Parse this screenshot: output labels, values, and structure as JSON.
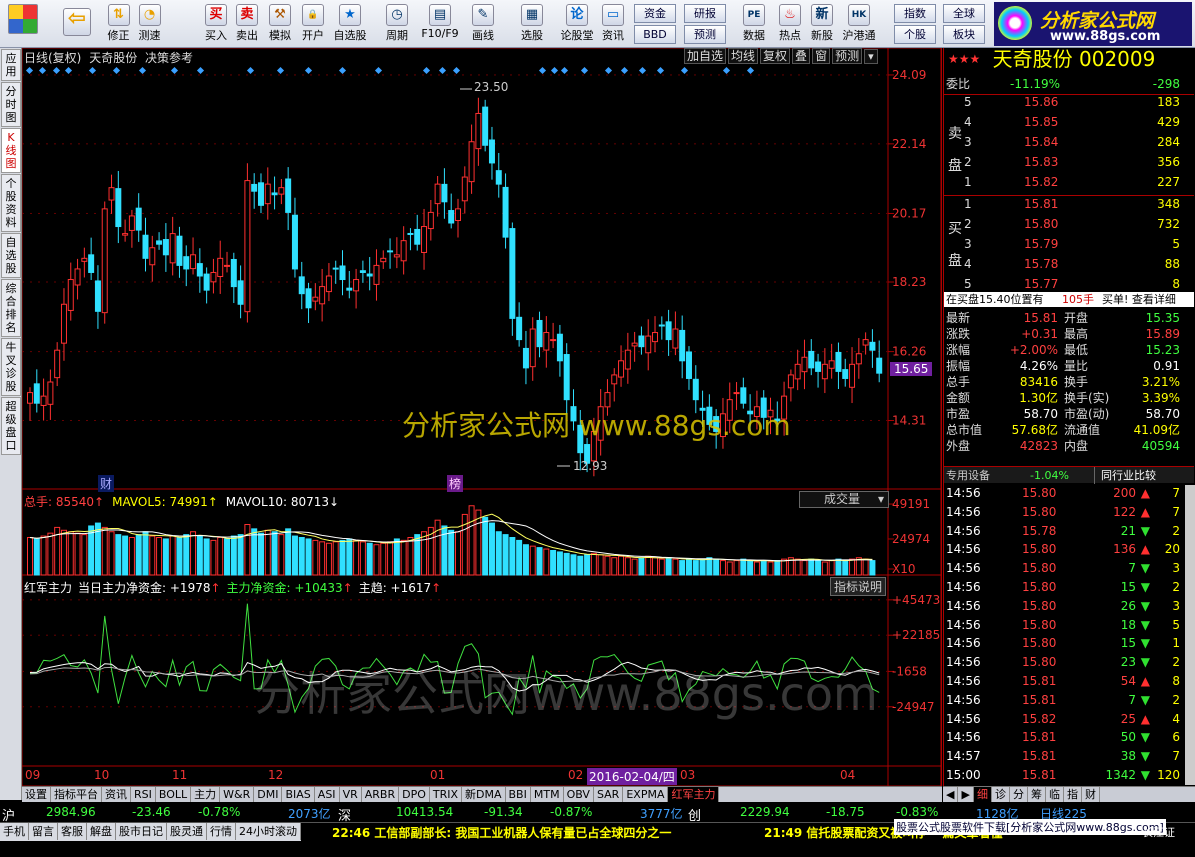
{
  "toolbar": {
    "left_buttons": [
      {
        "label": "买入",
        "icon": "buy-icon"
      },
      {
        "label": "卖出",
        "icon": "sell-icon"
      },
      {
        "label": "模拟",
        "icon": "hammer-icon"
      },
      {
        "label": "开户",
        "icon": "lock-icon"
      },
      {
        "label": "自选股",
        "icon": "star-icon"
      },
      {
        "label": "周期",
        "icon": "clock-icon"
      },
      {
        "label": "F10/F9",
        "icon": "f10-icon"
      },
      {
        "label": "画线",
        "icon": "pencil-icon"
      },
      {
        "label": "选股",
        "icon": "filter-icon"
      },
      {
        "label": "论股堂",
        "icon": "lun-icon"
      },
      {
        "label": "资讯",
        "icon": "doc-icon"
      },
      {
        "label": "数据",
        "icon": "pe-icon"
      },
      {
        "label": "热点",
        "icon": "fire-icon"
      },
      {
        "label": "新股",
        "icon": "newstock-icon"
      },
      {
        "label": "沪港通",
        "icon": "hk-icon"
      }
    ],
    "nav_buttons": [
      {
        "label": "修正",
        "icon": "up-down-icon"
      },
      {
        "label": "测速",
        "icon": "speed-icon"
      }
    ],
    "wide_buttons": [
      "资金",
      "研报",
      "BBD",
      "预测",
      "指数",
      "全球",
      "个股",
      "板块"
    ],
    "logo_text": "分析家公式网",
    "logo_url": "www.88gs.com"
  },
  "left_tabs": [
    {
      "label": "应用"
    },
    {
      "label": "分时图"
    },
    {
      "label": "K线图",
      "selected": true
    },
    {
      "label": "个股资料"
    },
    {
      "label": "自选股"
    },
    {
      "label": "综合排名"
    },
    {
      "label": "牛叉诊股"
    },
    {
      "label": "超级盘口"
    }
  ],
  "chart_header": {
    "title": "日线(复权)",
    "stock": "天奇股份",
    "mode": "决策参考",
    "buttons": [
      "加自选",
      "均线",
      "复权",
      "叠",
      "窗",
      "预测"
    ]
  },
  "watermark": "分析家公式网 www.88gs.com",
  "watermark2": "分析家公式网www.88gs.com",
  "price_axis": [
    "24.09",
    "22.14",
    "20.17",
    "18.23",
    "16.26",
    "14.31"
  ],
  "current_price_tag": "15.65",
  "hi_label": "23.50",
  "lo_label": "12.93",
  "event_labels": [
    "财",
    "榜"
  ],
  "volume_panel": {
    "header": [
      {
        "text": "总手: 85540",
        "color": "#ff4040"
      },
      {
        "text": "MAVOL5: 74991",
        "color": "#ffff00"
      },
      {
        "text": "MAVOL10: 80713",
        "color": "#ffffff"
      }
    ],
    "dropdown": "成交量",
    "axis": [
      "49191",
      "24974",
      "X10"
    ]
  },
  "indicator_panel": {
    "header": [
      {
        "text": "红军主力",
        "color": "#ffffff"
      },
      {
        "text": "当日主力净资金: +1978",
        "color": "#ffffff"
      },
      {
        "text": "主力净资金: +10433",
        "color": "#40ff40"
      },
      {
        "text": "主趋: +1617",
        "color": "#ffffff"
      }
    ],
    "button": "指标说明",
    "axis": [
      "+45473",
      "+22185",
      "-1658",
      "-24947"
    ]
  },
  "x_axis": [
    "09",
    "10",
    "11",
    "12",
    "01",
    "02",
    "03",
    "04"
  ],
  "x_cursor_date": "2016-02-04/四",
  "bottom_tabs": [
    "设置",
    "指标平台",
    "资讯",
    "RSI",
    "BOLL",
    "主力",
    "W&R",
    "DMI",
    "BIAS",
    "ASI",
    "VR",
    "ARBR",
    "DPO",
    "TRIX",
    "新DMA",
    "BBI",
    "MTM",
    "OBV",
    "SAR",
    "EXPMA",
    "红军主力"
  ],
  "right_tabs": [
    "细",
    "诊",
    "分",
    "筹",
    "临",
    "指",
    "财"
  ],
  "chart_data": {
    "type": "candlestick",
    "title": "天奇股份 日线(复权)",
    "ylim": [
      12.93,
      24.09
    ],
    "price_ticks": [
      24.09,
      22.14,
      20.17,
      18.23,
      16.26,
      14.31
    ],
    "high": 23.5,
    "low": 12.93,
    "last": 15.65,
    "close": [
      15.1,
      14.8,
      15.0,
      15.4,
      16.3,
      17.6,
      18.3,
      18.6,
      18.9,
      18.5,
      17.4,
      20.3,
      20.9,
      19.8,
      19.6,
      20.1,
      19.7,
      18.9,
      19.2,
      19.3,
      19.0,
      19.6,
      18.7,
      18.6,
      19.0,
      18.4,
      18.0,
      18.5,
      18.9,
      18.7,
      18.1,
      17.6,
      21.1,
      20.8,
      20.4,
      21.0,
      20.7,
      20.9,
      20.2,
      18.6,
      17.9,
      17.5,
      17.8,
      18.1,
      18.4,
      18.6,
      18.3,
      18.0,
      18.3,
      18.5,
      18.4,
      18.7,
      18.9,
      19.1,
      19.0,
      19.4,
      19.6,
      19.3,
      19.8,
      20.2,
      21.0,
      20.5,
      19.9,
      20.3,
      21.2,
      22.2,
      23.0,
      22.1,
      21.6,
      21.0,
      19.5,
      17.2,
      16.6,
      15.8,
      16.9,
      16.4,
      16.8,
      16.6,
      16.0,
      14.9,
      14.3,
      13.4,
      13.1,
      14.0,
      14.7,
      15.1,
      15.6,
      16.0,
      16.3,
      16.5,
      16.4,
      16.7,
      16.8,
      17.0,
      16.6,
      16.9,
      16.0,
      15.5,
      14.9,
      14.6,
      14.2,
      14.0,
      14.5,
      14.9,
      15.1,
      14.8,
      14.5,
      14.7,
      14.4,
      14.6,
      14.3,
      15.0,
      15.6,
      15.9,
      16.1,
      15.8,
      15.7,
      15.9,
      16.0,
      15.7,
      15.5,
      15.9,
      16.2,
      16.6,
      16.3,
      15.65
    ],
    "volume_x10": [
      26000,
      25000,
      27000,
      29000,
      33000,
      31000,
      30000,
      29000,
      28000,
      34000,
      36000,
      33000,
      30000,
      28000,
      27000,
      26000,
      28000,
      30000,
      27000,
      26000,
      25000,
      27000,
      26000,
      28000,
      30000,
      27000,
      25000,
      24000,
      26000,
      25000,
      27000,
      28000,
      35000,
      32000,
      29000,
      31000,
      30000,
      28000,
      32000,
      27000,
      26000,
      25000,
      24000,
      23000,
      22000,
      23000,
      24000,
      25000,
      24000,
      23000,
      22000,
      21000,
      22000,
      23000,
      25000,
      24000,
      26000,
      28000,
      30000,
      33000,
      38000,
      34000,
      31000,
      30000,
      42000,
      48000,
      45000,
      40000,
      36000,
      30000,
      28000,
      26000,
      24000,
      21000,
      20000,
      19000,
      18000,
      17000,
      16000,
      15000,
      14000,
      13000,
      14000,
      15000,
      14000,
      13000,
      12000,
      13000,
      12000,
      11000,
      12000,
      13000,
      12000,
      11000,
      12000,
      11000,
      10000,
      11000,
      10000,
      11000,
      12000,
      11000,
      10000,
      9000,
      10000,
      11000,
      10000,
      9000,
      10000,
      9000,
      10000,
      11000,
      12000,
      11000,
      10000,
      11000,
      10000,
      9000,
      10000,
      11000,
      10000,
      11000,
      12000,
      11000,
      10000
    ],
    "indicator": {
      "names": [
        "红军主力",
        "主力净资金",
        "主趋"
      ],
      "values": [
        1978,
        10433,
        1617
      ]
    }
  },
  "quote": {
    "title": "天奇股份 002009",
    "weibi_label": "委比",
    "weibi": "-11.19%",
    "weicha": "-298",
    "sell_label": [
      "卖",
      "盘"
    ],
    "buy_label": [
      "买",
      "盘"
    ],
    "asks": [
      {
        "n": "5",
        "p": "15.86",
        "v": "183"
      },
      {
        "n": "4",
        "p": "15.85",
        "v": "429"
      },
      {
        "n": "3",
        "p": "15.84",
        "v": "284"
      },
      {
        "n": "2",
        "p": "15.83",
        "v": "356"
      },
      {
        "n": "1",
        "p": "15.82",
        "v": "227"
      }
    ],
    "bids": [
      {
        "n": "1",
        "p": "15.81",
        "v": "348"
      },
      {
        "n": "2",
        "p": "15.80",
        "v": "732"
      },
      {
        "n": "3",
        "p": "15.79",
        "v": "5"
      },
      {
        "n": "4",
        "p": "15.78",
        "v": "88"
      },
      {
        "n": "5",
        "p": "15.77",
        "v": "8"
      }
    ],
    "buy_info": "在买盘15.40位置有",
    "buy_info_qty": "105手",
    "buy_info_link": "买单! 查看详细",
    "stats": [
      {
        "l1": "最新",
        "v1": "15.81",
        "c1": "#ff4040",
        "l2": "开盘",
        "v2": "15.35",
        "c2": "#40ff40"
      },
      {
        "l1": "涨跌",
        "v1": "+0.31",
        "c1": "#ff4040",
        "l2": "最高",
        "v2": "15.89",
        "c2": "#ff4040"
      },
      {
        "l1": "涨幅",
        "v1": "+2.00%",
        "c1": "#ff4040",
        "l2": "最低",
        "v2": "15.23",
        "c2": "#40ff40"
      },
      {
        "l1": "振幅",
        "v1": "4.26%",
        "c1": "#ffffff",
        "l2": "量比",
        "v2": "0.91",
        "c2": "#ffffff"
      },
      {
        "l1": "总手",
        "v1": "83416",
        "c1": "#ffff00",
        "l2": "换手",
        "v2": "3.21%",
        "c2": "#ffff00"
      },
      {
        "l1": "金额",
        "v1": "1.30亿",
        "c1": "#ffff00",
        "l2": "换手(实)",
        "v2": "3.39%",
        "c2": "#ffff00"
      },
      {
        "l1": "市盈",
        "v1": "58.70",
        "c1": "#ffffff",
        "l2": "市盈(动)",
        "v2": "58.70",
        "c2": "#ffffff"
      },
      {
        "l1": "总市值",
        "v1": "57.68亿",
        "c1": "#ffff00",
        "l2": "流通值",
        "v2": "41.09亿",
        "c2": "#ffff00"
      },
      {
        "l1": "外盘",
        "v1": "42823",
        "c1": "#ff4040",
        "l2": "内盘",
        "v2": "40594",
        "c2": "#40ff40"
      }
    ],
    "sector_label": "专用设备",
    "sector_change": "-1.04%",
    "compare_btn": "同行业比较",
    "ticks": [
      {
        "t": "14:56",
        "p": "15.80",
        "v": "200",
        "d": "up",
        "n": "7"
      },
      {
        "t": "14:56",
        "p": "15.80",
        "v": "122",
        "d": "up",
        "n": "7"
      },
      {
        "t": "14:56",
        "p": "15.78",
        "v": "21",
        "d": "down",
        "n": "2"
      },
      {
        "t": "14:56",
        "p": "15.80",
        "v": "136",
        "d": "up",
        "n": "20"
      },
      {
        "t": "14:56",
        "p": "15.80",
        "v": "7",
        "d": "down",
        "n": "3"
      },
      {
        "t": "14:56",
        "p": "15.80",
        "v": "15",
        "d": "down",
        "n": "2"
      },
      {
        "t": "14:56",
        "p": "15.80",
        "v": "26",
        "d": "down",
        "n": "3"
      },
      {
        "t": "14:56",
        "p": "15.80",
        "v": "18",
        "d": "down",
        "n": "5"
      },
      {
        "t": "14:56",
        "p": "15.80",
        "v": "15",
        "d": "down",
        "n": "1"
      },
      {
        "t": "14:56",
        "p": "15.80",
        "v": "23",
        "d": "down",
        "n": "2"
      },
      {
        "t": "14:56",
        "p": "15.81",
        "v": "54",
        "d": "up",
        "n": "8"
      },
      {
        "t": "14:56",
        "p": "15.81",
        "v": "7",
        "d": "down",
        "n": "2"
      },
      {
        "t": "14:56",
        "p": "15.82",
        "v": "25",
        "d": "up",
        "n": "4"
      },
      {
        "t": "14:56",
        "p": "15.81",
        "v": "50",
        "d": "down",
        "n": "6"
      },
      {
        "t": "14:57",
        "p": "15.81",
        "v": "38",
        "d": "down",
        "n": "7"
      },
      {
        "t": "15:00",
        "p": "15.81",
        "v": "1342",
        "d": "down",
        "n": "120"
      }
    ]
  },
  "market": [
    {
      "name": "沪",
      "price": "2984.96",
      "chg": "-23.46",
      "pct": "-0.78%",
      "amt": "2073亿"
    },
    {
      "name": "深",
      "price": "10413.54",
      "chg": "-91.34",
      "pct": "-0.87%",
      "amt": "3777亿"
    },
    {
      "name": "创",
      "price": "2229.94",
      "chg": "-18.75",
      "pct": "-0.83%",
      "amt": "1128亿"
    }
  ],
  "market_extra": "日线225",
  "ticker_tabs": [
    "手机",
    "留言",
    "客服",
    "解盘",
    "股市日记",
    "股灵通",
    "行情",
    "24小时滚动"
  ],
  "news": "22:46 工信部副部长: 我国工业机器人保有量已占全球四分之一",
  "news2": "21:49 信托股票配资又被叫停 一篇文章看懂",
  "promo": "股票公式股票软件下载[分析家公式网www.88gs.com]",
  "right_corner": "长江证"
}
